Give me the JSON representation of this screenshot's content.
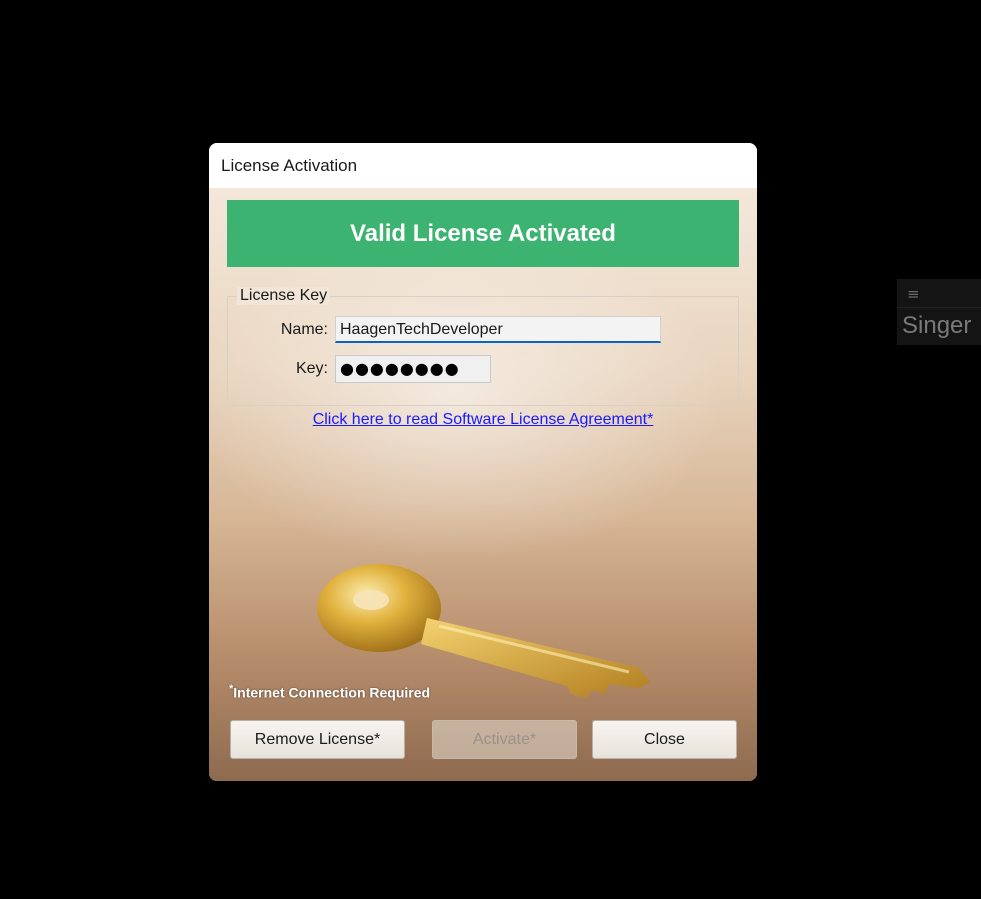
{
  "side_panel": {
    "menu_icon": "≡",
    "label": "Singer"
  },
  "dialog": {
    "title": "License Activation",
    "banner": "Valid License Activated",
    "license_group": {
      "legend": "License Key",
      "name_label": "Name:",
      "name_value": "HaagenTechDeveloper",
      "key_label": "Key:",
      "key_value": "●●●●●●●●"
    },
    "eula_link": "Click here to read Software License Agreement*",
    "note_star": "*",
    "note": "Internet Connection Required",
    "buttons": {
      "remove": "Remove License*",
      "activate": "Activate*",
      "close": "Close"
    },
    "colors": {
      "banner": "#3cb371",
      "link": "#1a1aff"
    }
  }
}
